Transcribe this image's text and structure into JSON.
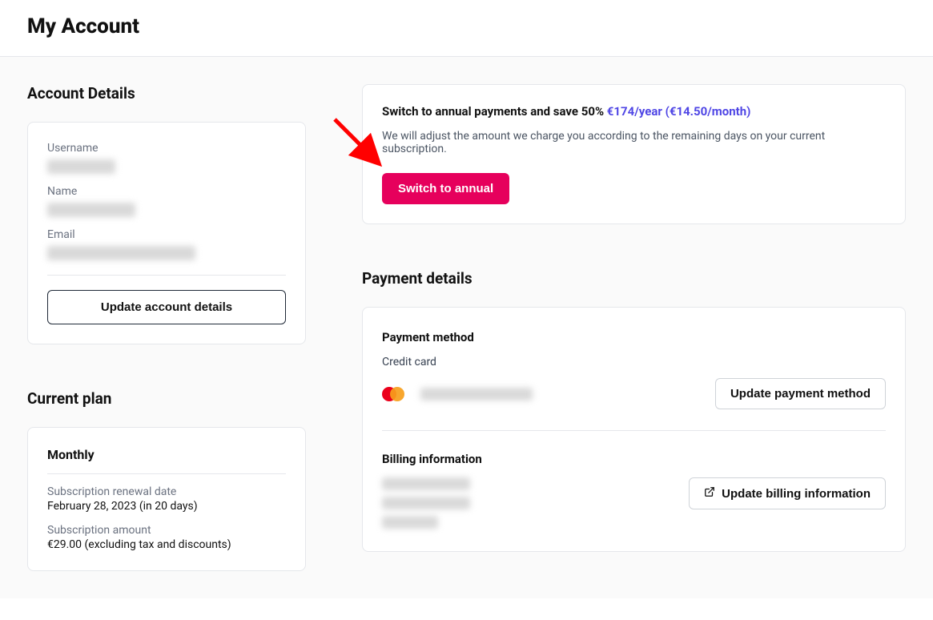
{
  "header": {
    "title": "My Account"
  },
  "accountDetails": {
    "heading": "Account Details",
    "usernameLabel": "Username",
    "nameLabel": "Name",
    "emailLabel": "Email",
    "updateButton": "Update account details"
  },
  "currentPlan": {
    "heading": "Current plan",
    "planName": "Monthly",
    "renewalLabel": "Subscription renewal date",
    "renewalValue": "February 28, 2023 (in 20 days)",
    "amountLabel": "Subscription amount",
    "amountValue": "€29.00 (excluding tax and discounts)"
  },
  "promo": {
    "leadBold": "Switch to annual payments and save 50%",
    "priceYear": "€174/year",
    "priceMonth": "(€14.50/month)",
    "body": "We will adjust the amount we charge you according to the remaining days on your current subscription.",
    "cta": "Switch to annual"
  },
  "payment": {
    "heading": "Payment details",
    "methodHeading": "Payment method",
    "methodType": "Credit card",
    "updateMethod": "Update payment method",
    "billingHeading": "Billing information",
    "updateBilling": "Update billing information"
  }
}
